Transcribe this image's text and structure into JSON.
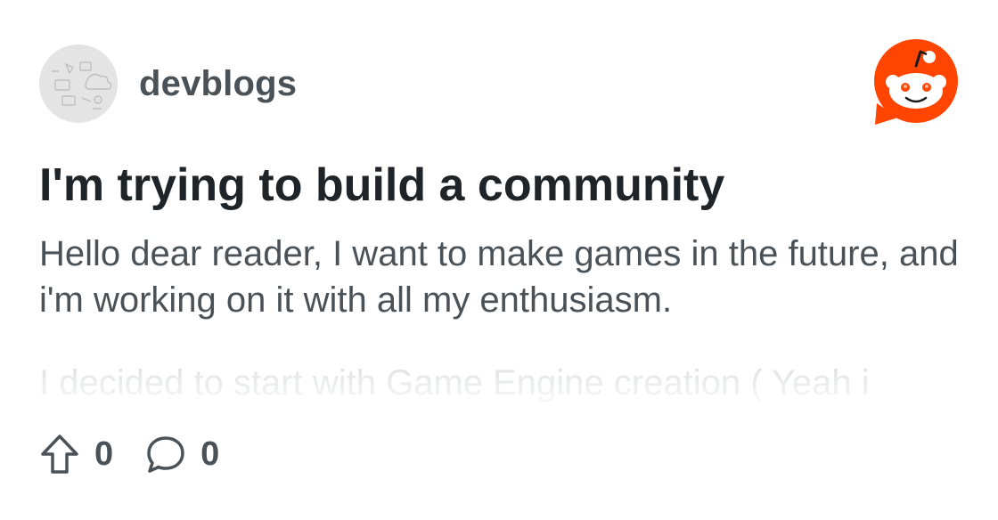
{
  "header": {
    "subreddit_name": "devblogs",
    "avatar_icon": "subreddit-avatar",
    "logo_icon": "reddit-logo-icon",
    "brand_color": "#ff4500"
  },
  "post": {
    "title": "I'm trying to build a community",
    "body": "Hello dear reader, I want to make games in the future, and i'm working on it with all my enthusiasm.",
    "preview_fade": "I decided to start with Game Engine creation ( Yeah i"
  },
  "footer": {
    "upvote_icon": "upvote-arrow-icon",
    "upvote_count": "0",
    "comment_icon": "comment-bubble-icon",
    "comment_count": "0"
  }
}
